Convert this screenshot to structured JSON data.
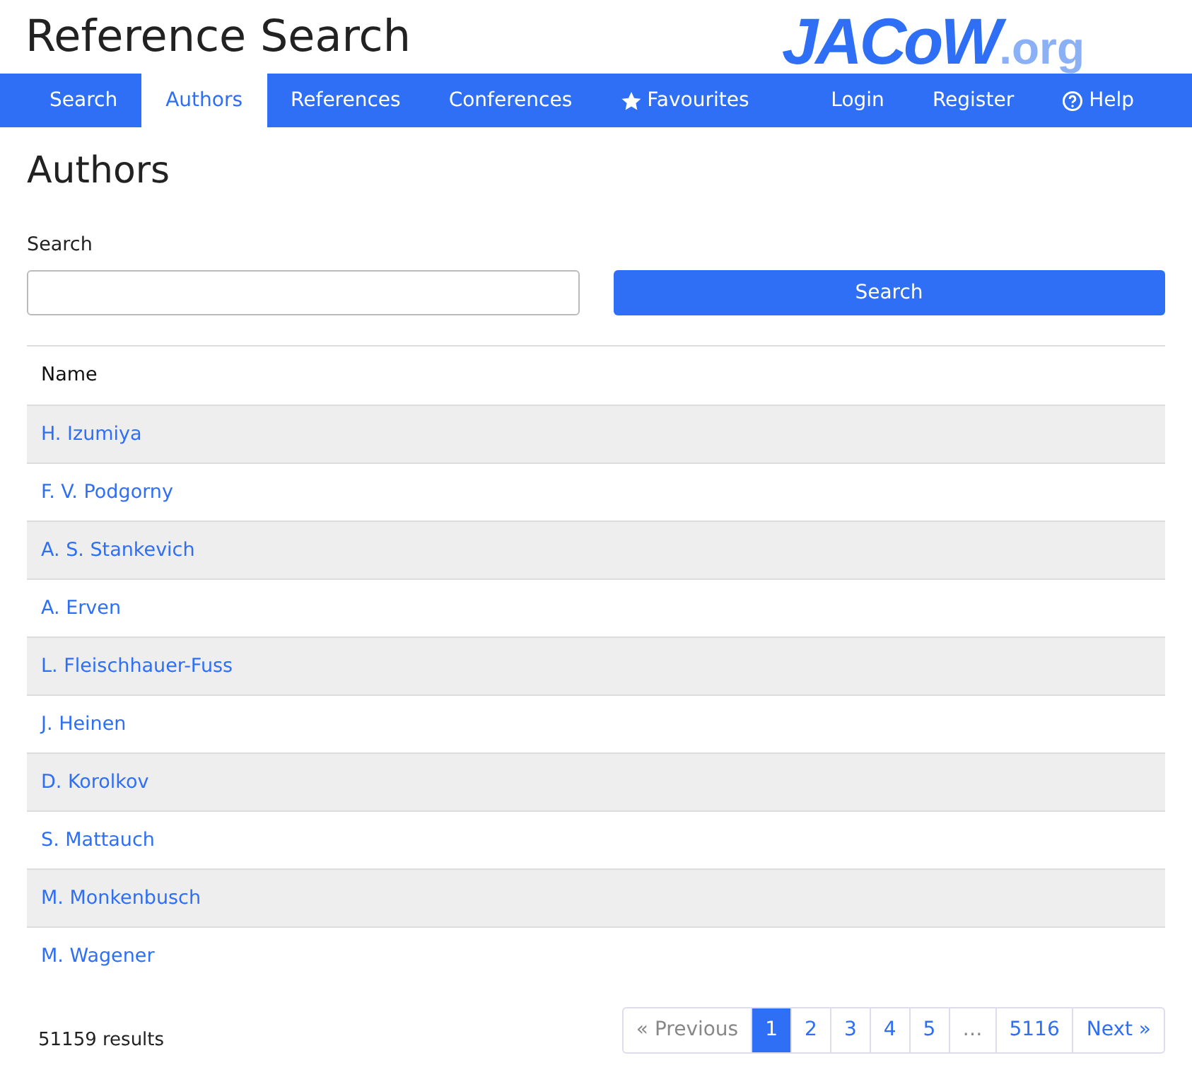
{
  "header": {
    "title": "Reference Search",
    "logo": {
      "main": "JACoW",
      "suffix": ".org"
    }
  },
  "nav": {
    "left": [
      {
        "label": "Search",
        "selected": false
      },
      {
        "label": "Authors",
        "selected": true
      },
      {
        "label": "References",
        "selected": false
      },
      {
        "label": "Conferences",
        "selected": false
      },
      {
        "label": "Favourites",
        "selected": false,
        "kind": "star"
      }
    ],
    "right": [
      {
        "label": "Login",
        "selected": false
      },
      {
        "label": "Register",
        "selected": false
      },
      {
        "label": "Help",
        "selected": false,
        "kind": "help"
      }
    ]
  },
  "page_title": "Authors",
  "search": {
    "label": "Search",
    "button": "Search"
  },
  "table": {
    "columns": [
      "Name"
    ],
    "rows": [
      {
        "name": "H. Izumiya"
      },
      {
        "name": "F. V. Podgorny"
      },
      {
        "name": "A. S. Stankevich"
      },
      {
        "name": "A. Erven"
      },
      {
        "name": "L. Fleischhauer-Fuss"
      },
      {
        "name": "J. Heinen"
      },
      {
        "name": "D. Korolkov"
      },
      {
        "name": "S. Mattauch"
      },
      {
        "name": "M. Monkenbusch"
      },
      {
        "name": "M. Wagener"
      }
    ]
  },
  "results": "51159 results",
  "pagination": [
    {
      "label": "« Previous",
      "selected": false,
      "disabled": true
    },
    {
      "label": "1",
      "selected": true,
      "disabled": false
    },
    {
      "label": "2",
      "selected": false,
      "disabled": false
    },
    {
      "label": "3",
      "selected": false,
      "disabled": false
    },
    {
      "label": "4",
      "selected": false,
      "disabled": false
    },
    {
      "label": "5",
      "selected": false,
      "disabled": false
    },
    {
      "label": "…",
      "selected": false,
      "disabled": true
    },
    {
      "label": "5116",
      "selected": false,
      "disabled": false
    },
    {
      "label": "Next »",
      "selected": false,
      "disabled": false
    }
  ]
}
